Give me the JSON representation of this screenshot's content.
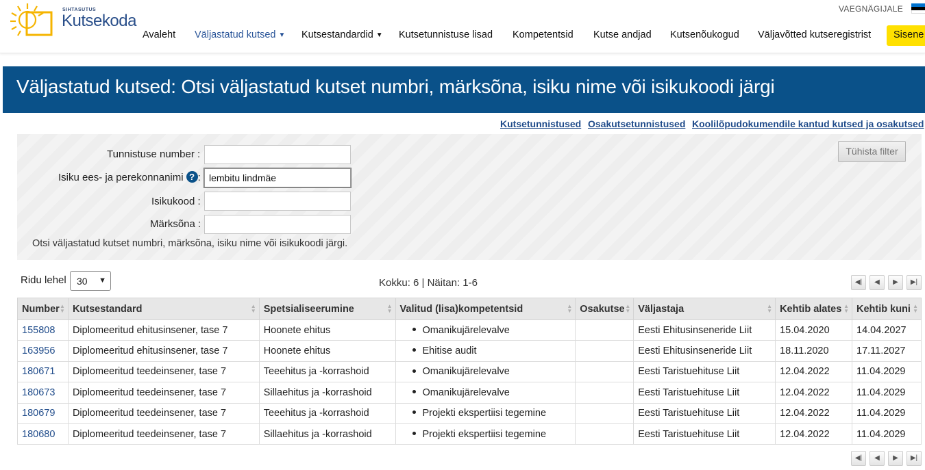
{
  "header": {
    "logo_small": "SIHTASUTUS",
    "logo_text": "Kutsekoda",
    "lang": "VAEGNÄGIJALE",
    "flag_colors": [
      "#0072ce",
      "#000000",
      "#ffffff"
    ],
    "nav": [
      {
        "label": "Avaleht"
      },
      {
        "label": "Väljastatud kutsed",
        "dropdown": true,
        "active": true
      },
      {
        "label": "Kutsestandardid",
        "dropdown": true
      },
      {
        "label": "Kutsetunnistuse lisad"
      },
      {
        "label": "Kompetentsid"
      },
      {
        "label": "Kutse andjad"
      },
      {
        "label": "Kutsenõukogud"
      },
      {
        "label": "Väljavõtted kutseregistrist"
      }
    ],
    "login": "Sisene"
  },
  "banner": {
    "title": "Väljastatud kutsed: Otsi väljastatud kutset numbri, märksõna, isiku nime või isikukoodi järgi"
  },
  "links": [
    "Kutsetunnistused",
    "Osakutsetunnistused",
    "Koolilõpudokumendile kantud kutsed ja osakutsed"
  ],
  "filter": {
    "cert_label": "Tunnistuse number :",
    "cert_value": "",
    "name_label": "Isiku ees- ja perekonnanimi",
    "name_value": "lembitu lindmäe",
    "code_label": "Isikukood :",
    "code_value": "",
    "keyword_label": "Märksõna :",
    "keyword_value": "",
    "hint": "Otsi väljastatud kutset numbri, märksõna, isiku nime või isikukoodi järgi.",
    "clear": "Tühista filter"
  },
  "paging": {
    "rows_label": "Ridu lehel",
    "rows_value": "30",
    "summary": "Kokku: 6 | Näitan: 1-6"
  },
  "table": {
    "columns": [
      "Number",
      "Kutsestandard",
      "Spetsialiseerumine",
      "Valitud (lisa)kompetentsid",
      "Osakutse",
      "Väljastaja",
      "Kehtib alates",
      "Kehtib kuni"
    ],
    "rows": [
      [
        "155808",
        "Diplomeeritud ehitusinsener, tase 7",
        "Hoonete ehitus",
        "Omanikujärelevalve",
        "",
        "Eesti Ehitusinseneride Liit",
        "15.04.2020",
        "14.04.2027"
      ],
      [
        "163956",
        "Diplomeeritud ehitusinsener, tase 7",
        "Hoonete ehitus",
        "Ehitise audit",
        "",
        "Eesti Ehitusinseneride Liit",
        "18.11.2020",
        "17.11.2027"
      ],
      [
        "180671",
        "Diplomeeritud teedeinsener, tase 7",
        "Teeehitus ja -korrashoid",
        "Omanikujärelevalve",
        "",
        "Eesti Taristuehituse Liit",
        "12.04.2022",
        "11.04.2029"
      ],
      [
        "180673",
        "Diplomeeritud teedeinsener, tase 7",
        "Sillaehitus ja -korrashoid",
        "Omanikujärelevalve",
        "",
        "Eesti Taristuehituse Liit",
        "12.04.2022",
        "11.04.2029"
      ],
      [
        "180679",
        "Diplomeeritud teedeinsener, tase 7",
        "Teeehitus ja -korrashoid",
        "Projekti ekspertiisi tegemine",
        "",
        "Eesti Taristuehituse Liit",
        "12.04.2022",
        "11.04.2029"
      ],
      [
        "180680",
        "Diplomeeritud teedeinsener, tase 7",
        "Sillaehitus ja -korrashoid",
        "Projekti ekspertiisi tegemine",
        "",
        "Eesti Taristuehituse Liit",
        "12.04.2022",
        "11.04.2029"
      ]
    ]
  }
}
